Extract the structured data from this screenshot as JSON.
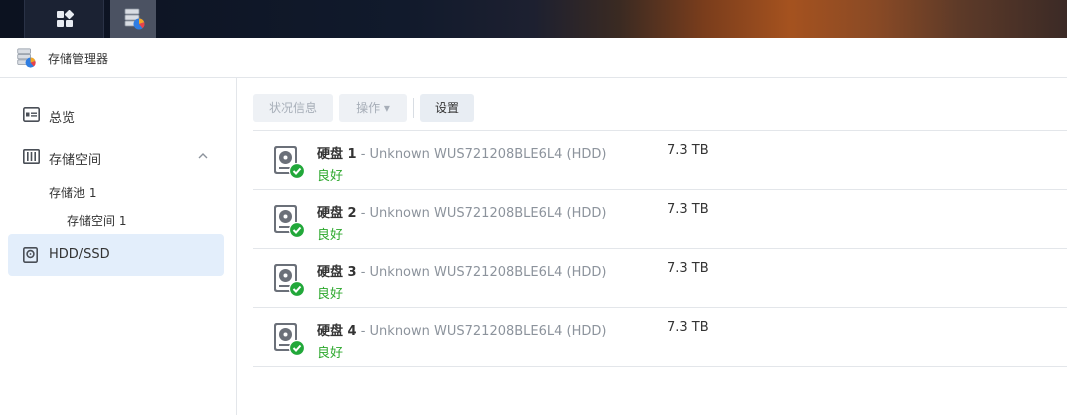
{
  "window": {
    "title": "存储管理器"
  },
  "taskbar": {
    "apps_icon": "grid-icon",
    "storage_icon": "storage-manager-icon"
  },
  "sidebar": {
    "items": [
      {
        "label": "总览",
        "icon": "overview-icon"
      },
      {
        "label": "存储空间",
        "icon": "storage-icon",
        "expanded": true
      },
      {
        "label": "HDD/SSD",
        "icon": "hdd-icon",
        "active": true
      }
    ],
    "sub_items": [
      {
        "label": "存储池 1"
      },
      {
        "label": "存储空间 1"
      }
    ]
  },
  "toolbar": {
    "status_label": "状况信息",
    "action_label": "操作 ▾",
    "settings_label": "设置"
  },
  "disks": [
    {
      "name": "硬盘 1",
      "model": " - Unknown WUS721208BLE6L4 (HDD)",
      "size": "7.3 TB",
      "status": "良好"
    },
    {
      "name": "硬盘 2",
      "model": " - Unknown WUS721208BLE6L4 (HDD)",
      "size": "7.3 TB",
      "status": "良好"
    },
    {
      "name": "硬盘 3",
      "model": " - Unknown WUS721208BLE6L4 (HDD)",
      "size": "7.3 TB",
      "status": "良好"
    },
    {
      "name": "硬盘 4",
      "model": " - Unknown WUS721208BLE6L4 (HDD)",
      "size": "7.3 TB",
      "status": "良好"
    }
  ],
  "colors": {
    "accent_active": "#e3eefb",
    "status_good": "#2da82d"
  }
}
